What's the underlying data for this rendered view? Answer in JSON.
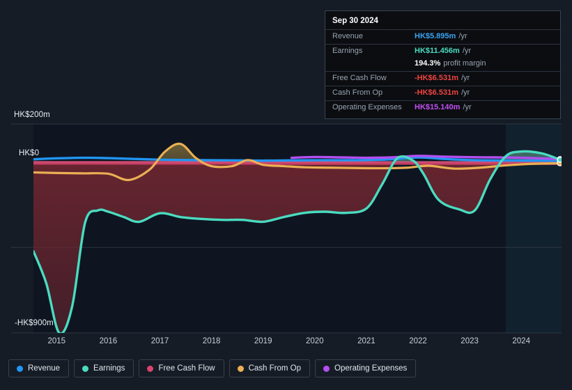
{
  "chart_data": {
    "type": "area",
    "title": "",
    "xlabel": "",
    "ylabel": "",
    "currency": "HK$",
    "units": "m",
    "grid": true,
    "legend_position": "bottom",
    "ylim": [
      -900,
      200
    ],
    "y_ticks": [
      {
        "value": 200,
        "label": "HK$200m"
      },
      {
        "value": 0,
        "label": "HK$0"
      },
      {
        "value": -900,
        "label": "-HK$900m"
      }
    ],
    "x_ticks": [
      "2015",
      "2016",
      "2017",
      "2018",
      "2019",
      "2020",
      "2021",
      "2022",
      "2023",
      "2024"
    ],
    "forecast_start": "2023.7",
    "series": [
      {
        "name": "Revenue",
        "color": "#2196f3",
        "x": [
          2014.55,
          2015.0,
          2015.5,
          2016.0,
          2016.5,
          2017.0,
          2017.5,
          2018.0,
          2018.5,
          2019.0,
          2019.5,
          2020.0,
          2020.5,
          2021.0,
          2021.5,
          2022.0,
          2022.5,
          2023.0,
          2023.5,
          2024.0,
          2024.75
        ],
        "values": [
          14,
          19,
          22,
          20,
          16,
          12,
          10,
          9,
          8,
          7,
          8,
          9,
          9,
          10,
          14,
          24,
          16,
          10,
          8,
          7,
          5.895
        ]
      },
      {
        "name": "Earnings",
        "color": "#4adbc0",
        "x": [
          2014.55,
          2014.8,
          2015.05,
          2015.3,
          2015.55,
          2015.8,
          2016.0,
          2016.3,
          2016.6,
          2017.0,
          2017.4,
          2017.8,
          2018.2,
          2018.6,
          2019.0,
          2019.4,
          2019.8,
          2020.2,
          2020.6,
          2021.0,
          2021.3,
          2021.6,
          2021.9,
          2022.1,
          2022.4,
          2022.8,
          2023.1,
          2023.4,
          2023.7,
          2024.0,
          2024.4,
          2024.75
        ],
        "values": [
          -470,
          -640,
          -900,
          -760,
          -320,
          -255,
          -262,
          -290,
          -315,
          -270,
          -290,
          -300,
          -305,
          -305,
          -315,
          -290,
          -268,
          -262,
          -268,
          -245,
          -120,
          20,
          8,
          -60,
          -200,
          -250,
          -255,
          -90,
          30,
          55,
          45,
          11.456
        ]
      },
      {
        "name": "Free Cash Flow",
        "color": "#d9446f",
        "x": [
          2014.55,
          2016.0,
          2018.0,
          2020.0,
          2022.0,
          2024.0,
          2024.75
        ],
        "values": [
          -5,
          -5,
          -5,
          -6,
          -6,
          -6,
          -6.531
        ]
      },
      {
        "name": "Cash From Op",
        "color": "#eab054",
        "x": [
          2014.55,
          2015.0,
          2015.5,
          2016.0,
          2016.4,
          2016.8,
          2017.1,
          2017.4,
          2017.7,
          2018.0,
          2018.4,
          2018.7,
          2019.0,
          2019.4,
          2019.8,
          2020.3,
          2020.8,
          2021.3,
          2021.8,
          2022.2,
          2022.7,
          2023.2,
          2023.7,
          2024.2,
          2024.75
        ],
        "values": [
          -55,
          -58,
          -60,
          -62,
          -95,
          -40,
          55,
          95,
          20,
          -22,
          -22,
          10,
          -15,
          -22,
          -28,
          -30,
          -32,
          -33,
          -30,
          -20,
          -35,
          -30,
          -18,
          -10,
          -6.531
        ]
      },
      {
        "name": "Operating Expenses",
        "color": "#b44ff0",
        "x": [
          2019.55,
          2020.0,
          2020.5,
          2021.0,
          2021.5,
          2022.0,
          2022.5,
          2023.0,
          2023.5,
          2024.0,
          2024.75
        ],
        "values": [
          22,
          26,
          24,
          22,
          24,
          32,
          28,
          25,
          24,
          22,
          15.14
        ]
      }
    ]
  },
  "tooltip": {
    "date": "Sep 30 2024",
    "rows": [
      {
        "label": "Revenue",
        "value": "HK$5.895m",
        "unit": "/yr",
        "color": "#3ba3f0",
        "rule": true
      },
      {
        "label": "Earnings",
        "value": "HK$11.456m",
        "unit": "/yr",
        "color": "#4adbc0",
        "rule": true
      },
      {
        "label": "",
        "value": "194.3%",
        "unit": "profit margin",
        "color": "#ffffff",
        "rule": false
      },
      {
        "label": "Free Cash Flow",
        "value": "-HK$6.531m",
        "unit": "/yr",
        "color": "#f0443f",
        "rule": true
      },
      {
        "label": "Cash From Op",
        "value": "-HK$6.531m",
        "unit": "/yr",
        "color": "#f0443f",
        "rule": true
      },
      {
        "label": "Operating Expenses",
        "value": "HK$15.140m",
        "unit": "/yr",
        "color": "#c44ff5",
        "rule": true
      }
    ]
  },
  "legend": {
    "items": [
      {
        "label": "Revenue",
        "color": "#2196f3"
      },
      {
        "label": "Earnings",
        "color": "#4adbc0"
      },
      {
        "label": "Free Cash Flow",
        "color": "#d9446f"
      },
      {
        "label": "Cash From Op",
        "color": "#eab054"
      },
      {
        "label": "Operating Expenses",
        "color": "#b44ff0"
      }
    ]
  },
  "colors": {
    "background": "#151c26",
    "plot_background": "#0e1521",
    "forecast_background": "#12212e",
    "gridline": "#2d3643",
    "zero_line": "#9aa6b4",
    "negative_fill": "#6d2630"
  }
}
